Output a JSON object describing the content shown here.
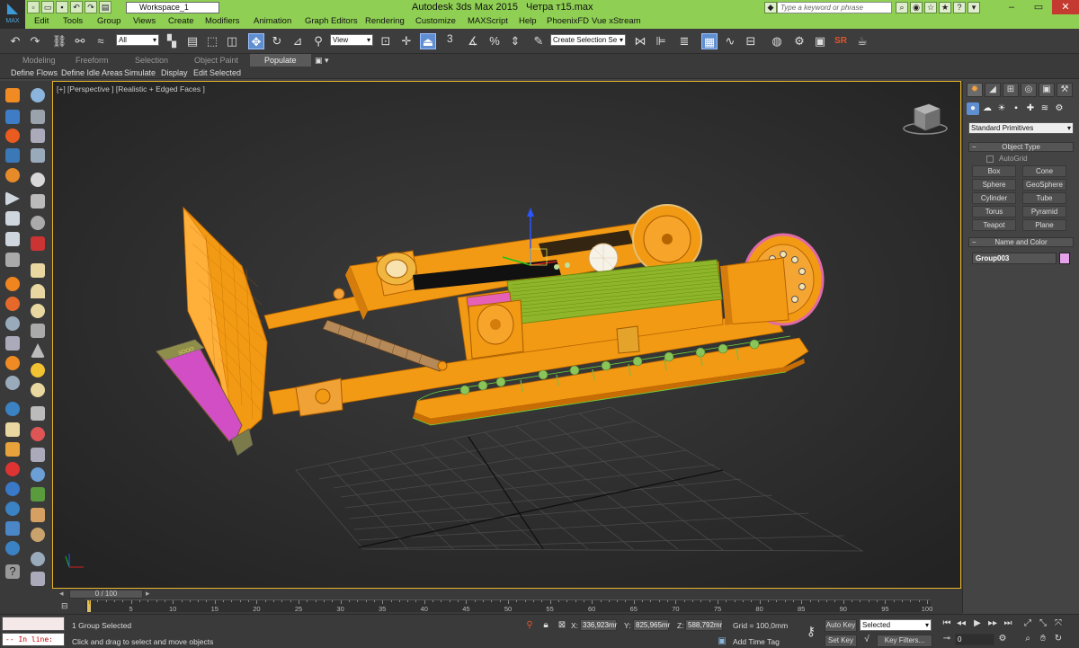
{
  "titlebar": {
    "workspace": "Workspace_1",
    "app_title": "Autodesk 3ds Max  2015",
    "file_name": "Четра т15.max",
    "search_placeholder": "Type a keyword or phrase"
  },
  "logo": {
    "label": "MAX"
  },
  "menu": [
    "Edit",
    "Tools",
    "Group",
    "Views",
    "Create",
    "Modifiers",
    "Animation",
    "Graph Editors",
    "Rendering",
    "Customize",
    "MAXScript",
    "Help",
    "PhoenixFD",
    "Vue xStream"
  ],
  "toolbar": {
    "selection_filter": "All",
    "ref_coord": "View",
    "snap_number": "3",
    "named_selection": "Create Selection Se",
    "sr_label": "SR"
  },
  "ribbon": {
    "tabs": [
      "Modeling",
      "Freeform",
      "Selection",
      "Object Paint",
      "Populate"
    ],
    "active_tab": "Populate",
    "items": [
      "Define Flows",
      "Define Idle Areas",
      "Simulate",
      "Display",
      "Edit Selected"
    ]
  },
  "viewport": {
    "label": "[+] [Perspective ] [Realistic + Edged Faces ]",
    "plate_text": "SOOO"
  },
  "command_panel": {
    "dropdown": "Standard Primitives",
    "object_type_header": "Object Type",
    "autogrid_label": "AutoGrid",
    "primitives": [
      "Box",
      "Cone",
      "Sphere",
      "GeoSphere",
      "Cylinder",
      "Tube",
      "Torus",
      "Pyramid",
      "Teapot",
      "Plane"
    ],
    "name_color_header": "Name and Color",
    "object_name": "Group003",
    "object_color": "#e4a2e8"
  },
  "timeline": {
    "slider_label": "0 / 100",
    "current_frame": 0,
    "total_frames": 100,
    "tick_labels": [
      "0",
      "5",
      "10",
      "15",
      "20",
      "25",
      "30",
      "35",
      "40",
      "45",
      "50",
      "55",
      "60",
      "65",
      "70",
      "75",
      "80",
      "85",
      "90",
      "95",
      "100"
    ]
  },
  "status": {
    "inline_label": "-- In line:",
    "selection_info": "1 Group Selected",
    "prompt": "Click and drag to select and move objects",
    "x_label": "X:",
    "x_value": "336,923mr",
    "y_label": "Y:",
    "y_value": "825,965mr",
    "z_label": "Z:",
    "z_value": "588,792mr",
    "grid": "Grid = 100,0mm",
    "add_time_tag": "Add Time Tag",
    "auto_key": "Auto Key",
    "set_key": "Set Key",
    "key_mode": "Selected",
    "key_filters": "Key Filters...",
    "frame_field": "0"
  },
  "colors": {
    "titlebar": "#8fcf54",
    "viewport_border": "#e7b42c",
    "model_orange": "#f39a14",
    "wire_green": "#66c24a",
    "accent_blue": "#5f8fd0"
  }
}
